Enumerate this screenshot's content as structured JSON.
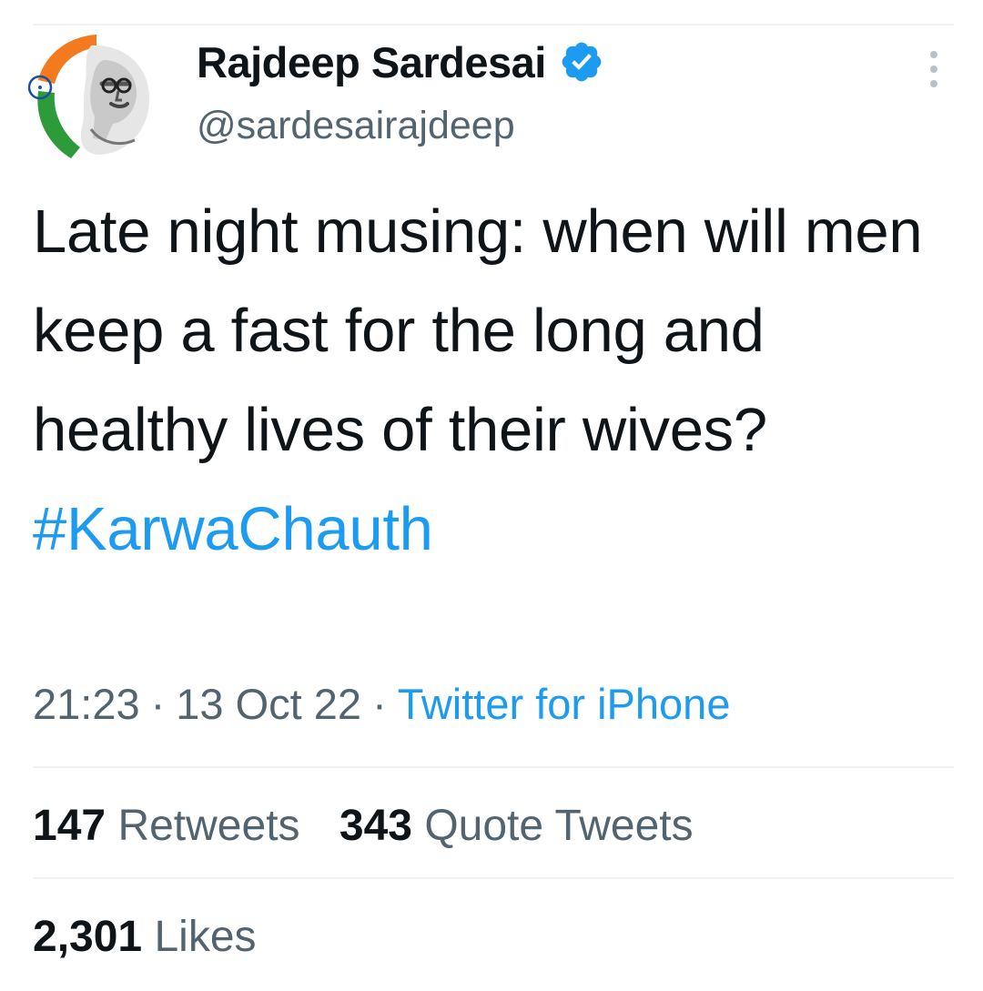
{
  "author": {
    "display_name": "Rajdeep Sardesai",
    "handle": "@sardesairajdeep",
    "verified": true,
    "avatar": "avatar-icon"
  },
  "tweet": {
    "text": "Late night musing: when will men keep a fast for the long and healthy lives of their wives?",
    "hashtag": "#KarwaChauth",
    "time": "21:23",
    "separator": "·",
    "date": "13 Oct 22",
    "source": "Twitter for iPhone"
  },
  "stats": {
    "retweets_count": "147",
    "retweets_label": "Retweets",
    "quotes_count": "343",
    "quotes_label": "Quote Tweets",
    "likes_count": "2,301",
    "likes_label": "Likes"
  },
  "colors": {
    "link": "#1d9bf0",
    "text_primary": "#0f1419",
    "text_secondary": "#536471",
    "divider": "#eff3f4"
  }
}
